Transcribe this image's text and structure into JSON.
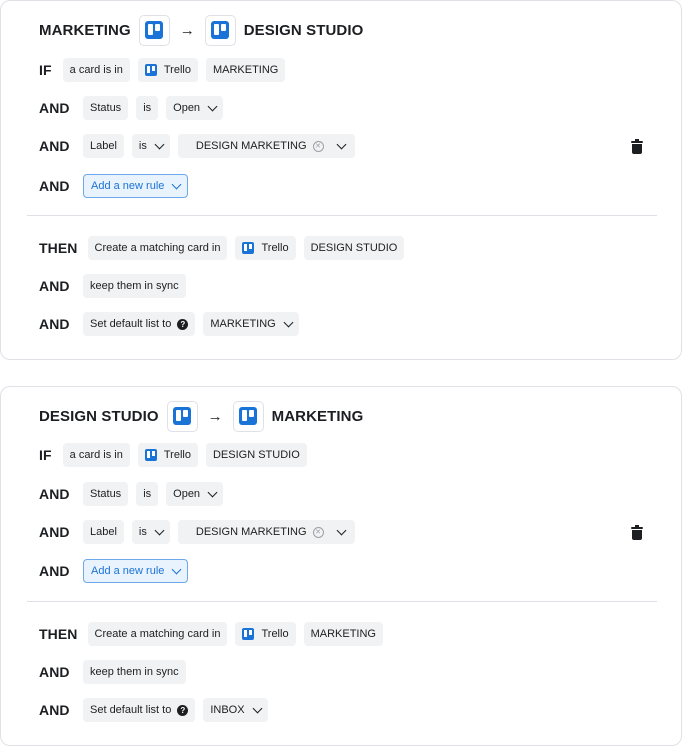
{
  "icons": {
    "trello": "trello-icon",
    "arrow": "right-arrow",
    "delete": "trash-icon",
    "clear": "x-circle-icon",
    "help": "question-circle-icon",
    "dropdown": "chevron-down-icon"
  },
  "colors": {
    "trello_blue": "#1a73d6",
    "add_rule_bg": "#e9f3fd",
    "add_rule_border": "#6da9ea",
    "chip_bg": "#f1f2f4"
  },
  "flows": [
    {
      "title_source": "MARKETING",
      "arrow": "→",
      "title_target": "DESIGN STUDIO",
      "if_kw": "IF",
      "if_text": "a card is in",
      "if_app": "Trello",
      "if_board": "MARKETING",
      "and_kw": "AND",
      "status_field": "Status",
      "status_op": "is",
      "status_value": "Open",
      "label_field": "Label",
      "label_op": "is",
      "label_value": "DESIGN MARKETING",
      "add_rule": "Add a new rule",
      "then_kw": "THEN",
      "then_text": "Create a matching card in",
      "then_app": "Trello",
      "then_board": "DESIGN STUDIO",
      "sync_text": "keep them in sync",
      "default_list_text": "Set default list to",
      "default_list_value": "MARKETING"
    },
    {
      "title_source": "DESIGN STUDIO",
      "arrow": "→",
      "title_target": "MARKETING",
      "if_kw": "IF",
      "if_text": "a card is in",
      "if_app": "Trello",
      "if_board": "DESIGN STUDIO",
      "and_kw": "AND",
      "status_field": "Status",
      "status_op": "is",
      "status_value": "Open",
      "label_field": "Label",
      "label_op": "is",
      "label_value": "DESIGN MARKETING",
      "add_rule": "Add a new rule",
      "then_kw": "THEN",
      "then_text": "Create a matching card in",
      "then_app": "Trello",
      "then_board": "MARKETING",
      "sync_text": "keep them in sync",
      "default_list_text": "Set default list to",
      "default_list_value": "INBOX"
    }
  ]
}
